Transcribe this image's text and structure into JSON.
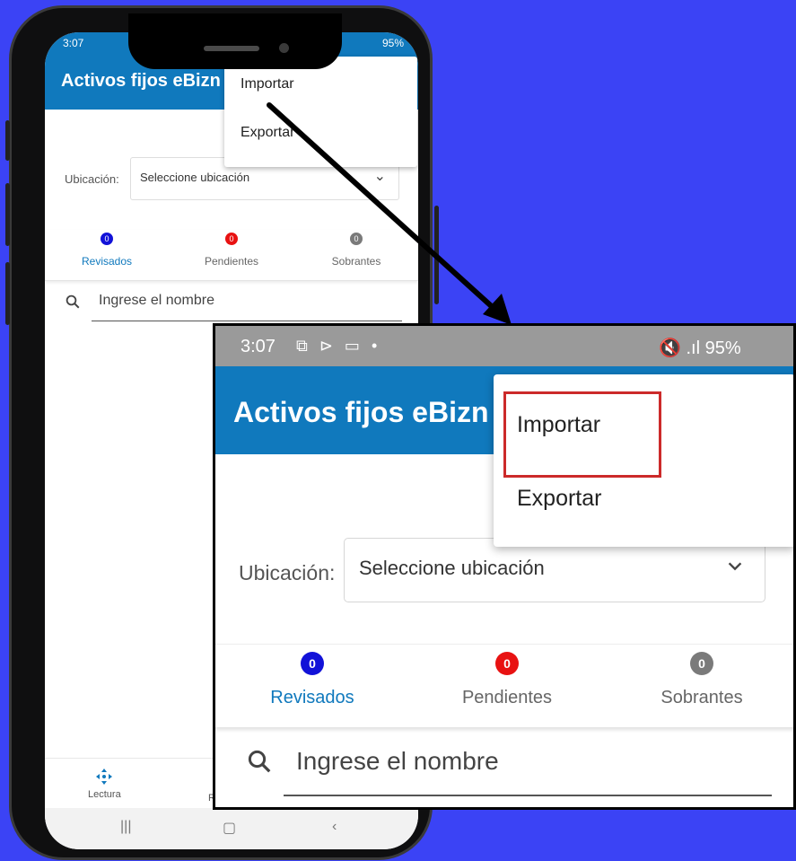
{
  "app": {
    "title": "Activos fijos eBizn"
  },
  "status_bar": {
    "time": "3:07",
    "left_icons": "⧉ ⊳ ▭ •",
    "right": "🔇 .ıl 95%",
    "phone_time_partial": "3:07",
    "phone_right_partial": "95%"
  },
  "menu": {
    "items": [
      {
        "label": "Importar"
      },
      {
        "label": "Exportar"
      }
    ],
    "highlighted": "Importar"
  },
  "location": {
    "label": "Ubicación:",
    "placeholder": "Seleccione ubicación"
  },
  "tabs": [
    {
      "label": "Revisados",
      "count": "0",
      "badge_color": "#1212d8",
      "active": true
    },
    {
      "label": "Pendientes",
      "count": "0",
      "badge_color": "#e81212",
      "active": false
    },
    {
      "label": "Sobrantes",
      "count": "0",
      "badge_color": "#7a7a7a",
      "active": false
    }
  ],
  "search": {
    "placeholder": "Ingrese el nombre"
  },
  "bottom_nav": {
    "lectura": "Lectura",
    "second_partial": "Re"
  },
  "system_nav": {
    "recents": "|||",
    "home": "▢",
    "back": "‹"
  },
  "colors": {
    "background": "#3b43f5",
    "brand_blue": "#1079bd",
    "highlight_red": "#cc2a2a",
    "active_tab": "#1079bd"
  }
}
